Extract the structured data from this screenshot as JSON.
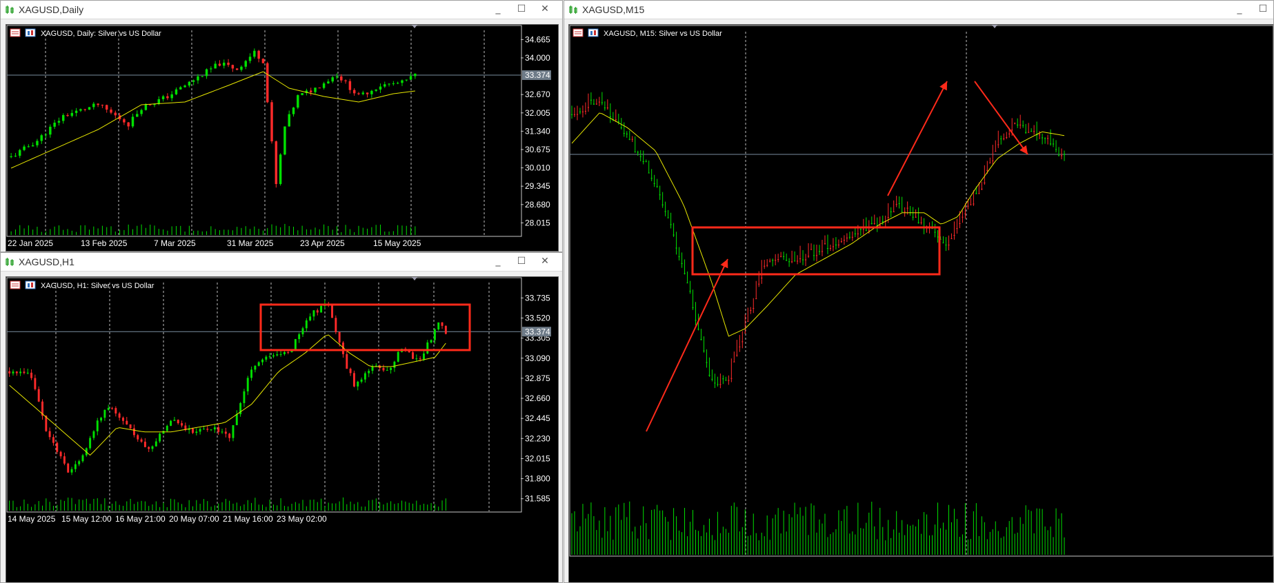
{
  "windows": {
    "daily": {
      "title": "XAGUSD,Daily",
      "chart_label": "XAGUSD, Daily:  Silver vs US Dollar"
    },
    "h1": {
      "title": "XAGUSD,H1",
      "chart_label": "XAGUSD, H1:  Silver vs US Dollar"
    },
    "m15": {
      "title": "XAGUSD,M15",
      "chart_label": "XAGUSD, M15:  Silver vs US Dollar"
    }
  },
  "window_buttons": {
    "minimize": "_",
    "maximize": "☐",
    "close": "✕"
  },
  "colors": {
    "bull": "#00e000",
    "bear": "#ff2a2a",
    "ma": "#e8e800",
    "grid": "#c0c0c0",
    "bid": "#7a8ea0",
    "annotation": "#ff2a1a",
    "price_tag": "#6e7b88"
  },
  "chart_data": [
    {
      "id": "daily",
      "type": "candlestick",
      "title": "XAGUSD, Daily:  Silver vs US Dollar",
      "current_price": "33.374",
      "y_ticks": [
        "34.665",
        "34.000",
        "32.670",
        "32.005",
        "31.340",
        "30.675",
        "30.010",
        "29.345",
        "28.680",
        "28.015"
      ],
      "ylim": [
        27.55,
        35.0
      ],
      "x_labels": [
        "22 Jan 2025",
        "13 Feb 2025",
        "7 Mar 2025",
        "31 Mar 2025",
        "23 Apr 2025",
        "15 May 2025"
      ],
      "candle_count": 94,
      "price_path": [
        [
          0,
          30.4
        ],
        [
          6,
          31.0
        ],
        [
          12,
          31.9
        ],
        [
          20,
          32.3
        ],
        [
          27,
          31.6
        ],
        [
          30,
          32.2
        ],
        [
          36,
          32.6
        ],
        [
          42,
          33.2
        ],
        [
          48,
          33.8
        ],
        [
          52,
          33.6
        ],
        [
          56,
          34.2
        ],
        [
          58,
          33.9
        ],
        [
          61,
          29.4
        ],
        [
          63,
          31.5
        ],
        [
          66,
          32.6
        ],
        [
          70,
          32.9
        ],
        [
          75,
          33.4
        ],
        [
          80,
          32.6
        ],
        [
          85,
          33.0
        ],
        [
          90,
          33.1
        ],
        [
          93,
          33.37
        ]
      ],
      "ma_path": [
        [
          0,
          30.0
        ],
        [
          20,
          31.4
        ],
        [
          30,
          32.3
        ],
        [
          40,
          32.4
        ],
        [
          50,
          33.0
        ],
        [
          58,
          33.5
        ],
        [
          64,
          32.9
        ],
        [
          72,
          32.6
        ],
        [
          80,
          32.4
        ],
        [
          88,
          32.7
        ],
        [
          93,
          32.8
        ]
      ],
      "volume_level": 0.35
    },
    {
      "id": "h1",
      "type": "candlestick",
      "title": "XAGUSD, H1:  Silver vs US Dollar",
      "current_price": "33.374",
      "y_ticks": [
        "33.735",
        "33.520",
        "33.305",
        "33.090",
        "32.875",
        "32.660",
        "32.445",
        "32.230",
        "32.015",
        "31.800",
        "31.585"
      ],
      "ylim": [
        31.45,
        33.9
      ],
      "x_labels": [
        "14 May 2025",
        "15 May 12:00",
        "16 May 21:00",
        "20 May 07:00",
        "21 May 16:00",
        "23 May 02:00"
      ],
      "candle_count": 120,
      "price_path": [
        [
          0,
          32.95
        ],
        [
          8,
          32.9
        ],
        [
          14,
          32.3
        ],
        [
          22,
          31.85
        ],
        [
          28,
          32.1
        ],
        [
          36,
          32.6
        ],
        [
          44,
          32.35
        ],
        [
          52,
          32.1
        ],
        [
          60,
          32.45
        ],
        [
          68,
          32.3
        ],
        [
          75,
          32.35
        ],
        [
          82,
          32.25
        ],
        [
          90,
          33.0
        ],
        [
          96,
          33.1
        ],
        [
          104,
          33.15
        ],
        [
          110,
          33.5
        ],
        [
          118,
          33.7
        ],
        [
          124,
          33.1
        ],
        [
          128,
          32.8
        ],
        [
          134,
          33.0
        ],
        [
          140,
          32.95
        ],
        [
          146,
          33.2
        ],
        [
          152,
          33.05
        ],
        [
          160,
          33.5
        ],
        [
          162,
          33.37
        ]
      ],
      "ma_path": [
        [
          0,
          32.8
        ],
        [
          20,
          32.3
        ],
        [
          30,
          32.05
        ],
        [
          40,
          32.35
        ],
        [
          50,
          32.3
        ],
        [
          60,
          32.3
        ],
        [
          70,
          32.35
        ],
        [
          80,
          32.4
        ],
        [
          90,
          32.6
        ],
        [
          100,
          32.95
        ],
        [
          110,
          33.15
        ],
        [
          118,
          33.35
        ],
        [
          126,
          33.15
        ],
        [
          134,
          33.0
        ],
        [
          142,
          33.0
        ],
        [
          150,
          33.05
        ],
        [
          158,
          33.1
        ],
        [
          162,
          33.25
        ]
      ],
      "volume_level": 0.3
    },
    {
      "id": "m15",
      "type": "candlestick",
      "title": "XAGUSD, M15:  Silver vs US Dollar",
      "current_price": "33.374",
      "candle_count": 180,
      "price_path": [
        [
          0,
          0.12
        ],
        [
          10,
          0.08
        ],
        [
          20,
          0.18
        ],
        [
          30,
          0.3
        ],
        [
          40,
          0.52
        ],
        [
          50,
          0.82
        ],
        [
          56,
          0.8
        ],
        [
          62,
          0.66
        ],
        [
          68,
          0.52
        ],
        [
          74,
          0.49
        ],
        [
          80,
          0.5
        ],
        [
          86,
          0.48
        ],
        [
          92,
          0.46
        ],
        [
          98,
          0.44
        ],
        [
          104,
          0.42
        ],
        [
          110,
          0.4
        ],
        [
          116,
          0.36
        ],
        [
          122,
          0.38
        ],
        [
          130,
          0.44
        ],
        [
          134,
          0.47
        ],
        [
          136,
          0.42
        ],
        [
          140,
          0.38
        ],
        [
          146,
          0.3
        ],
        [
          152,
          0.2
        ],
        [
          158,
          0.14
        ],
        [
          164,
          0.17
        ],
        [
          170,
          0.18
        ],
        [
          176,
          0.24
        ]
      ],
      "ma_path": [
        [
          0,
          0.2
        ],
        [
          10,
          0.12
        ],
        [
          20,
          0.16
        ],
        [
          30,
          0.22
        ],
        [
          40,
          0.36
        ],
        [
          50,
          0.56
        ],
        [
          56,
          0.7
        ],
        [
          62,
          0.68
        ],
        [
          70,
          0.62
        ],
        [
          80,
          0.54
        ],
        [
          90,
          0.5
        ],
        [
          100,
          0.46
        ],
        [
          110,
          0.41
        ],
        [
          118,
          0.38
        ],
        [
          126,
          0.38
        ],
        [
          132,
          0.41
        ],
        [
          138,
          0.39
        ],
        [
          144,
          0.32
        ],
        [
          152,
          0.24
        ],
        [
          160,
          0.2
        ],
        [
          168,
          0.17
        ],
        [
          176,
          0.18
        ]
      ],
      "volume_level": 0.45
    }
  ]
}
